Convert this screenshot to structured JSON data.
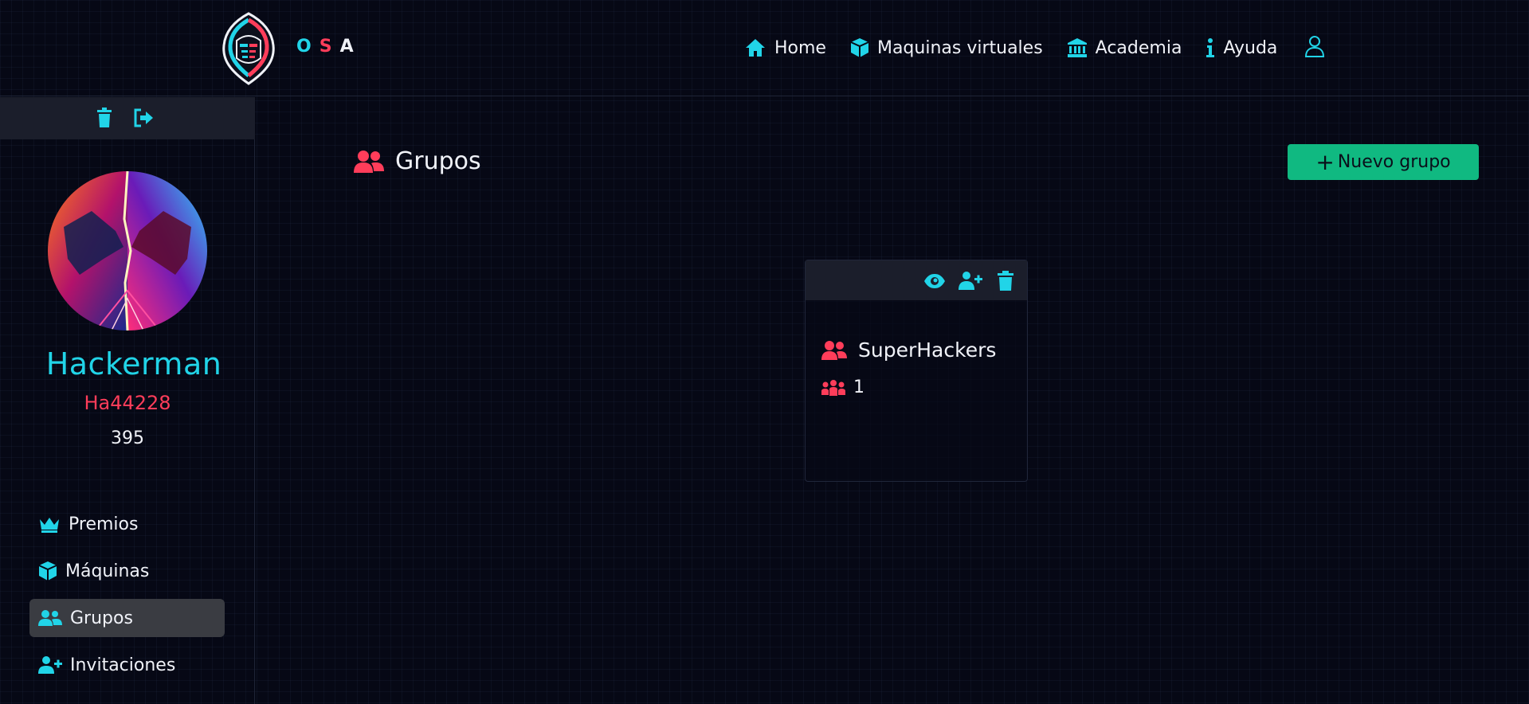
{
  "navbar": {
    "brand": [
      "O",
      "S",
      "A"
    ],
    "links": [
      {
        "label": "Home",
        "icon": "home-icon"
      },
      {
        "label": "Maquinas virtuales",
        "icon": "cube-icon"
      },
      {
        "label": "Academia",
        "icon": "bank-icon"
      },
      {
        "label": "Ayuda",
        "icon": "info-icon"
      }
    ],
    "user_icon": "user-icon"
  },
  "sidebar": {
    "tools": [
      "trash-icon",
      "logout-icon"
    ],
    "name": "Hackerman",
    "handle": "Ha44228",
    "points": "395",
    "items": [
      {
        "label": "Premios",
        "icon": "crown-icon"
      },
      {
        "label": "Máquinas",
        "icon": "cube-icon"
      },
      {
        "label": "Grupos",
        "icon": "users-icon",
        "active": true
      },
      {
        "label": "Invitaciones",
        "icon": "user-plus-icon"
      }
    ]
  },
  "main": {
    "title": "Grupos",
    "new_group_label": "Nuevo grupo",
    "cards": [
      {
        "name": "SuperHackers",
        "members": "1",
        "tools": [
          "eye-icon",
          "user-plus-icon",
          "trash-icon"
        ]
      }
    ]
  },
  "colors": {
    "background": "#060815",
    "accent_cyan": "#21d4e8",
    "accent_red": "#ff3d5a",
    "button_green": "#10b981",
    "panel": "#1b1e2b",
    "active_item": "#3a3c42"
  }
}
